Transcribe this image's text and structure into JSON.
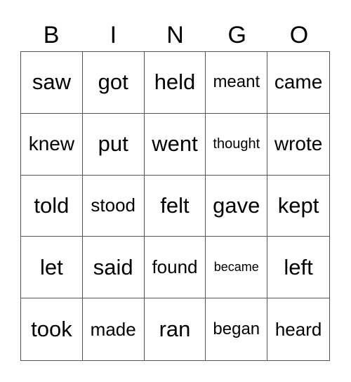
{
  "header": [
    "B",
    "I",
    "N",
    "G",
    "O"
  ],
  "cells": [
    "saw",
    "got",
    "held",
    "meant",
    "came",
    "knew",
    "put",
    "went",
    "thought",
    "wrote",
    "told",
    "stood",
    "felt",
    "gave",
    "kept",
    "let",
    "said",
    "found",
    "became",
    "left",
    "took",
    "made",
    "ran",
    "began",
    "heard"
  ]
}
